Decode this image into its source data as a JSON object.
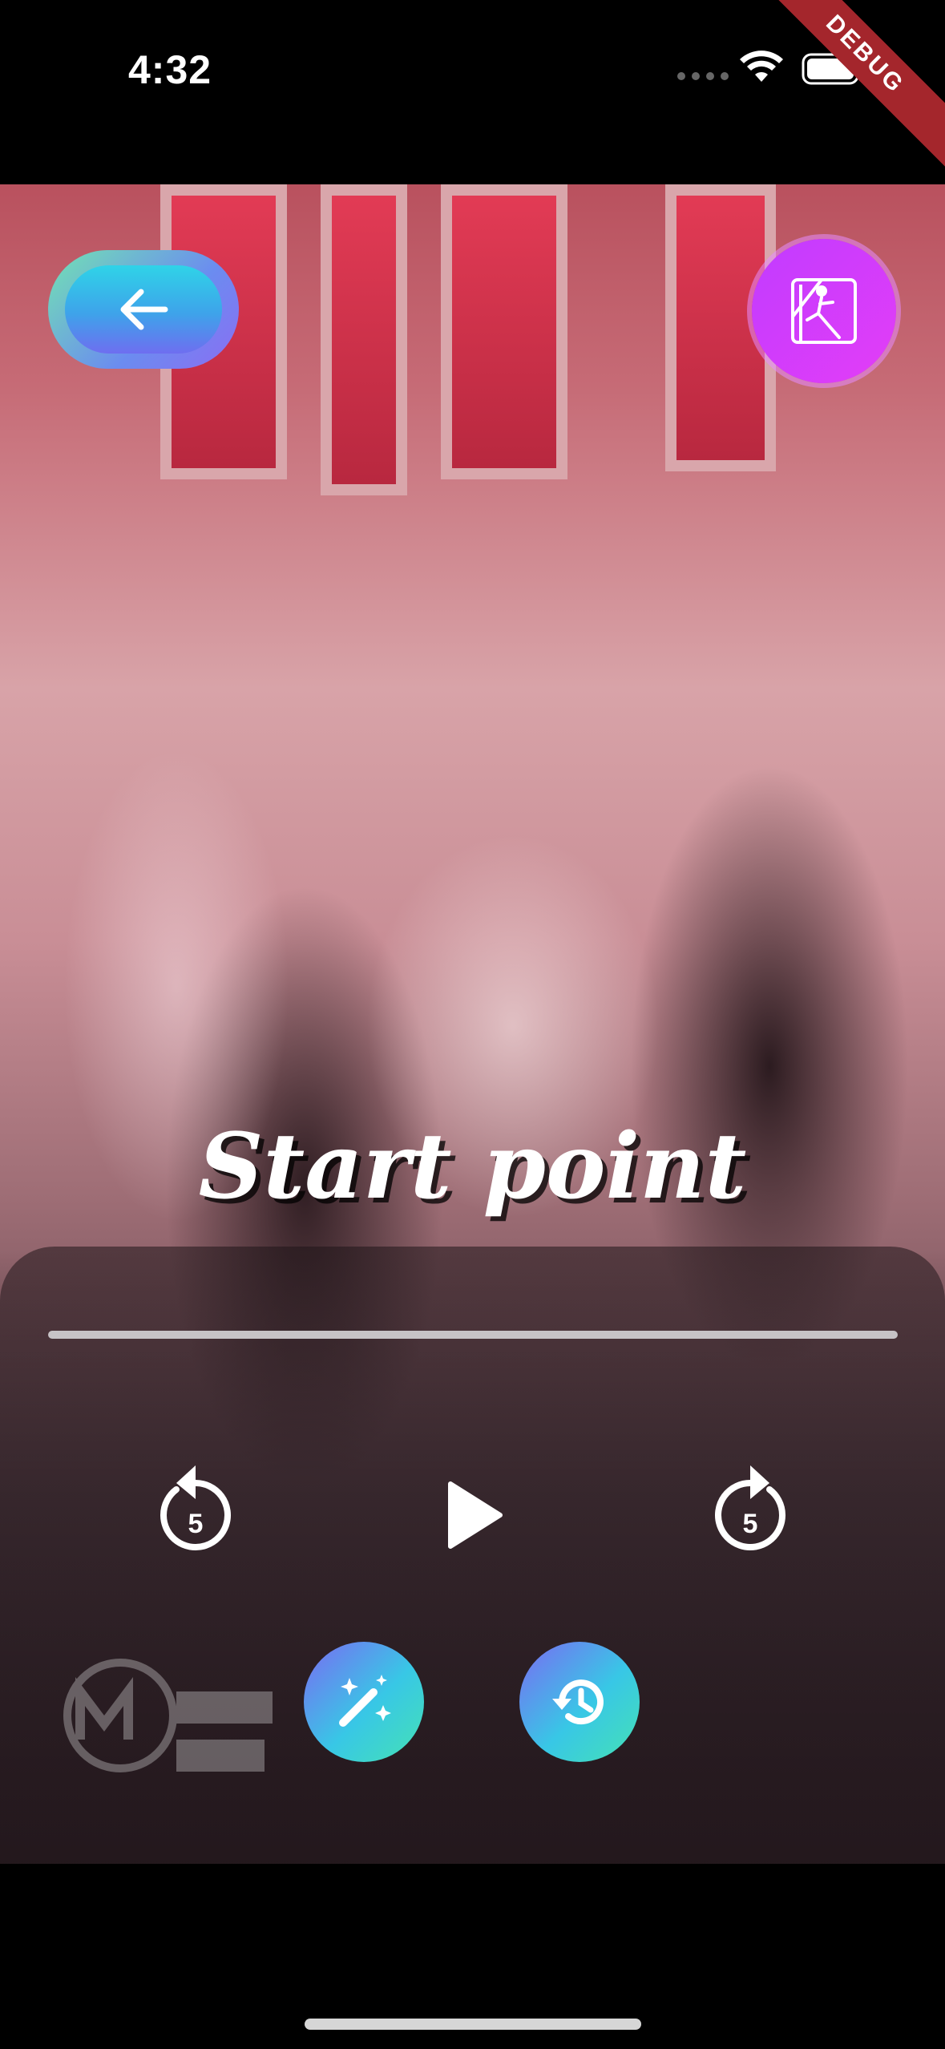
{
  "status_bar": {
    "time": "4:32"
  },
  "debug_banner": {
    "label": "DEBUG"
  },
  "header": {
    "back_icon": "arrow-left-icon",
    "model_icon": "keypoint-figure-icon"
  },
  "overlay": {
    "title": "Start point"
  },
  "playback": {
    "progress": 0.0,
    "rewind_seconds": "5",
    "forward_seconds": "5",
    "play_icon": "play-icon",
    "state": "paused"
  },
  "actions": {
    "magic_icon": "magic-wand-icon",
    "history_icon": "history-icon"
  },
  "colors": {
    "accent_teal": "#38c7e6",
    "accent_purple": "#c13cff",
    "debug_red": "#a4262c"
  }
}
